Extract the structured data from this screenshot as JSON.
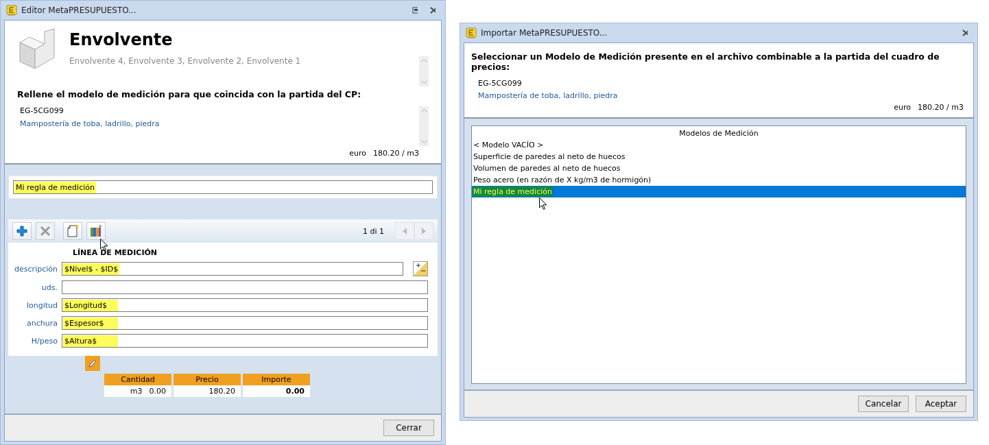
{
  "editor_window": {
    "title": "Editor MetaPRESUPUESTO...",
    "header": {
      "title": "Envolvente",
      "path": "Envolvente 4, Envolvente 3, Envolvente 2, Envolvente 1",
      "instruction": "Rellene el modelo de medición para que coincida con la partida del CP:",
      "code": "EG-5CG099",
      "description": "Mampostería de toba, ladrillo, piedra",
      "currency": "euro",
      "price": "180.20 / m3"
    },
    "rule_name": {
      "value": "Mi regla de medición",
      "highlighted": true
    },
    "toolbar": [
      {
        "kind": "add",
        "disabled": false
      },
      {
        "kind": "delete",
        "disabled": true
      },
      {
        "kind": "new",
        "disabled": false
      },
      {
        "kind": "library",
        "disabled": false
      }
    ],
    "pager": {
      "text": "1 di 1",
      "buttons": [
        {
          "kind": "prev",
          "disabled": true
        },
        {
          "kind": "next",
          "disabled": true
        }
      ]
    },
    "section_title": "LÍNEA DE MEDICIÓN",
    "fields": [
      {
        "label": "descripción",
        "value": "$Nivel$ - $ID$",
        "highlighted": true,
        "kind": "with-button"
      },
      {
        "label": "uds.",
        "highlighted": false,
        "kind": "plain"
      },
      {
        "label": "longitud",
        "value": "$Longitud$",
        "highlighted": true,
        "kind": "plain"
      },
      {
        "label": "anchura",
        "value": "$Espesor$",
        "highlighted": true,
        "kind": "plain"
      },
      {
        "label": "H/peso",
        "value": "$Altura$",
        "highlighted": true,
        "kind": "plain"
      }
    ],
    "totals": [
      {
        "label": "Cantidad",
        "unit": "m3",
        "value": "0.00",
        "bold": false
      },
      {
        "label": "Precio",
        "value": "180.20",
        "bold": false
      },
      {
        "label": "Importe",
        "value": "0.00",
        "bold": true
      }
    ],
    "buttons": [
      "Cerrar"
    ]
  },
  "import_window": {
    "title": "Importar MetaPRESUPUESTO...",
    "header": {
      "instruction": "Seleccionar un Modelo de Medición presente en el archivo combinable a la partida del cuadro de precios:",
      "code": "EG-5CG099",
      "description": "Mampostería de toba, ladrillo, piedra",
      "currency": "euro",
      "price": "180.20 / m3"
    },
    "list": {
      "heading": "Modelos de Medición",
      "items": [
        {
          "label": "< Modelo VACÍO >",
          "selected": false
        },
        {
          "label": "Superficie de paredes al neto de huecos",
          "selected": false
        },
        {
          "label": "Volumen de paredes al neto de huecos",
          "selected": false
        },
        {
          "label": "Peso acero (en razón de X kg/m3 de hormigón)",
          "selected": false
        },
        {
          "label": "Mi regla de medición",
          "selected": true
        }
      ]
    },
    "buttons": [
      "Cancelar",
      "Aceptar"
    ]
  }
}
